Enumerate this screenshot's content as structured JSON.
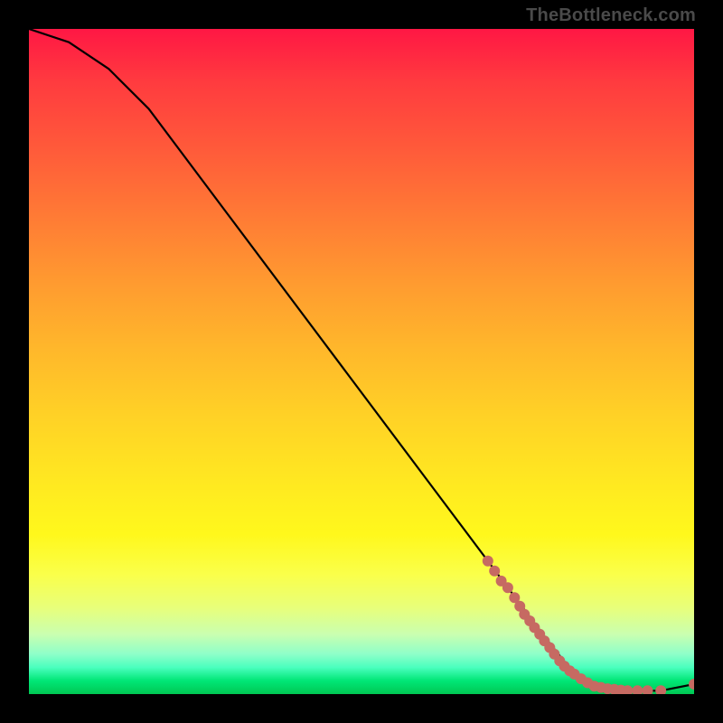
{
  "attribution": "TheBottleneck.com",
  "chart_data": {
    "type": "line",
    "title": "",
    "xlabel": "",
    "ylabel": "",
    "x_range": [
      0,
      100
    ],
    "y_range": [
      0,
      100
    ],
    "curve": [
      {
        "x": 0,
        "y": 100
      },
      {
        "x": 6,
        "y": 98
      },
      {
        "x": 12,
        "y": 94
      },
      {
        "x": 18,
        "y": 88
      },
      {
        "x": 30,
        "y": 72
      },
      {
        "x": 45,
        "y": 52
      },
      {
        "x": 60,
        "y": 32
      },
      {
        "x": 72,
        "y": 16
      },
      {
        "x": 78,
        "y": 8
      },
      {
        "x": 82,
        "y": 3
      },
      {
        "x": 86,
        "y": 1
      },
      {
        "x": 90,
        "y": 0.5
      },
      {
        "x": 95,
        "y": 0.5
      },
      {
        "x": 100,
        "y": 1.5
      }
    ],
    "points": [
      {
        "x": 69,
        "y": 20
      },
      {
        "x": 70,
        "y": 18.5
      },
      {
        "x": 71,
        "y": 17
      },
      {
        "x": 72,
        "y": 16
      },
      {
        "x": 73,
        "y": 14.5
      },
      {
        "x": 73.8,
        "y": 13.2
      },
      {
        "x": 74.5,
        "y": 12
      },
      {
        "x": 75.3,
        "y": 11
      },
      {
        "x": 76,
        "y": 10
      },
      {
        "x": 76.8,
        "y": 9
      },
      {
        "x": 77.5,
        "y": 8
      },
      {
        "x": 78.3,
        "y": 7
      },
      {
        "x": 79,
        "y": 6
      },
      {
        "x": 79.8,
        "y": 5
      },
      {
        "x": 80.5,
        "y": 4.2
      },
      {
        "x": 81.3,
        "y": 3.5
      },
      {
        "x": 82,
        "y": 3
      },
      {
        "x": 83,
        "y": 2.3
      },
      {
        "x": 84,
        "y": 1.7
      },
      {
        "x": 85,
        "y": 1.2
      },
      {
        "x": 86,
        "y": 1
      },
      {
        "x": 87,
        "y": 0.8
      },
      {
        "x": 88,
        "y": 0.7
      },
      {
        "x": 89,
        "y": 0.6
      },
      {
        "x": 90,
        "y": 0.5
      },
      {
        "x": 91.5,
        "y": 0.5
      },
      {
        "x": 93,
        "y": 0.5
      },
      {
        "x": 95,
        "y": 0.5
      },
      {
        "x": 100,
        "y": 1.5
      }
    ],
    "colors": {
      "curve": "#000000",
      "points": "#c66a62"
    }
  }
}
